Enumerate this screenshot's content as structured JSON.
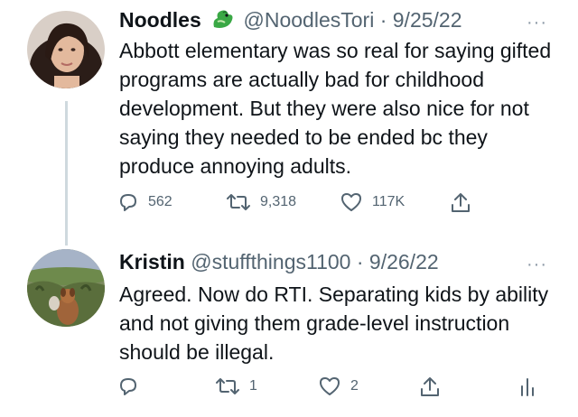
{
  "tweets": [
    {
      "display_name": "Noodles",
      "badge_icon": "dragon-emoji-icon",
      "handle": "@NoodlesTori",
      "separator": "·",
      "date": "9/25/22",
      "more_label": "···",
      "text": "Abbott elementary was so real for saying gifted programs are actually bad for childhood development. But they were also nice for not saying they needed to be ended bc they produce annoying adults.",
      "replies": "562",
      "retweets": "9,318",
      "likes": "117K"
    },
    {
      "display_name": "Kristin",
      "handle": "@stuffthings1100",
      "separator": "·",
      "date": "9/26/22",
      "more_label": "···",
      "text": "Agreed. Now do RTI. Separating kids by ability and not giving them grade-level instruction should be illegal.",
      "replies": "",
      "retweets": "1",
      "likes": "2"
    }
  ],
  "colors": {
    "text": "#0f1419",
    "muted": "#536471",
    "thread_line": "#cfd9de",
    "badge_green": "#3aa845"
  }
}
